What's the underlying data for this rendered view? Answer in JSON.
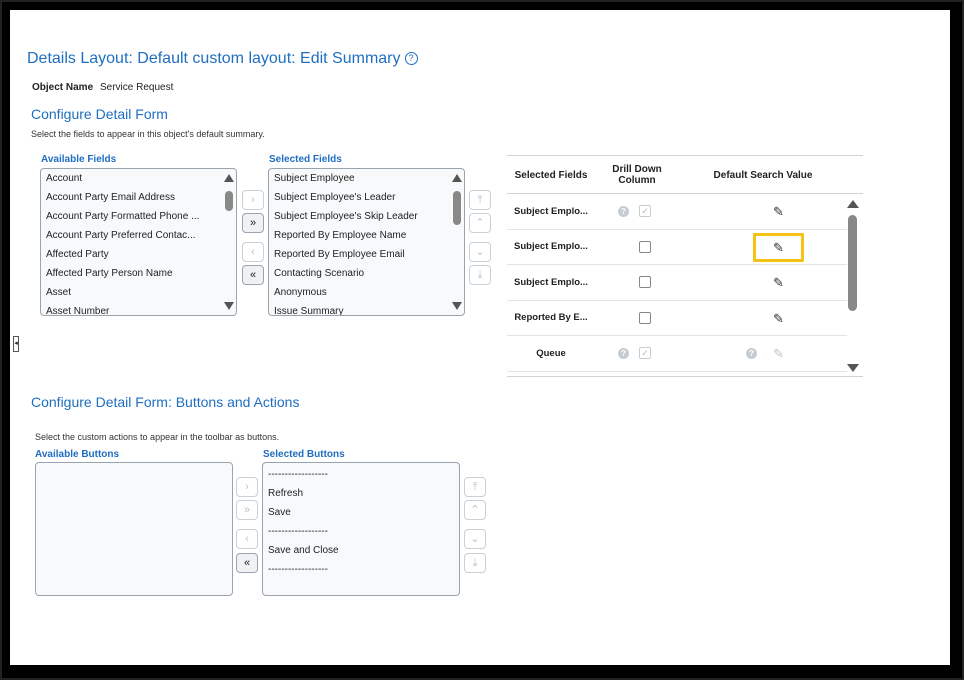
{
  "header": {
    "title": "Details Layout: Default custom layout: Edit Summary",
    "help_icon": "?",
    "object_name_label": "Object Name",
    "object_name_value": "Service Request"
  },
  "detail_form": {
    "title": "Configure Detail Form",
    "description": "Select the fields to appear in this object's default summary.",
    "available_label": "Available Fields",
    "available_fields": [
      "Account",
      "Account Party Email Address",
      "Account Party Formatted Phone ...",
      "Account Party Preferred Contac...",
      "Affected Party",
      "Affected Party Person Name",
      "Asset",
      "Asset Number"
    ],
    "selected_label": "Selected Fields",
    "selected_fields": [
      "Subject Employee",
      "Subject Employee's Leader",
      "Subject Employee's Skip Leader",
      "Reported By Employee Name",
      "Reported By Employee Email",
      "Contacting Scenario",
      "Anonymous",
      "Issue Summary"
    ],
    "move_buttons": {
      "move_right": "›",
      "move_all_right": "»",
      "move_left": "‹",
      "move_all_left": "«"
    },
    "order_buttons": {
      "top": "⤒",
      "up": "⌃",
      "down": "⌄",
      "bottom": "⤓"
    }
  },
  "summary_table": {
    "headers": {
      "selected_fields": "Selected Fields",
      "drill_down": "Drill Down Column",
      "default_search": "Default Search Value"
    },
    "rows": [
      {
        "field": "Subject Emplo...",
        "drill_checked": true,
        "drill_disabled": true,
        "search_disabled": false
      },
      {
        "field": "Subject Emplo...",
        "drill_checked": false,
        "drill_disabled": false,
        "search_disabled": false,
        "highlighted": true
      },
      {
        "field": "Subject Emplo...",
        "drill_checked": false,
        "drill_disabled": false,
        "search_disabled": false
      },
      {
        "field": "Reported By E...",
        "drill_checked": false,
        "drill_disabled": false,
        "search_disabled": false
      },
      {
        "field": "Queue",
        "drill_checked": true,
        "drill_disabled": true,
        "search_disabled": true
      }
    ],
    "highlight_color": "#f4c316"
  },
  "buttons_actions": {
    "title": "Configure Detail Form: Buttons and Actions",
    "description": "Select the custom actions to appear in the toolbar as buttons.",
    "available_label": "Available Buttons",
    "available_buttons": [],
    "selected_label": "Selected Buttons",
    "selected_buttons": [
      "------------------",
      "Refresh",
      "Save",
      "------------------",
      "Save and Close",
      "------------------"
    ]
  },
  "colors": {
    "accent": "#1f6ec0",
    "frame": "#000000"
  }
}
